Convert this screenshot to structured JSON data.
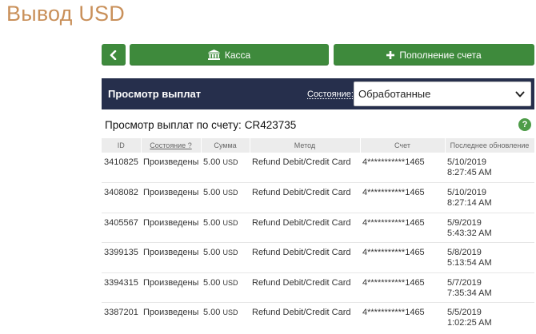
{
  "page": {
    "title": "Вывод USD"
  },
  "toolbar": {
    "kassa_label": "Касса",
    "topup_label": "Пополнение счета"
  },
  "panel": {
    "title": "Просмотр выплат",
    "state_label": "Состояние:",
    "state_value": "Обработанные"
  },
  "account": {
    "label": "Просмотр выплат по счету:",
    "number": "CR423735"
  },
  "help": {
    "label": "?"
  },
  "table": {
    "headers": {
      "id": "ID",
      "state": "Состояние ?",
      "sum": "Сумма",
      "method": "Метод",
      "account": "Счет",
      "updated": "Последнее обновление"
    },
    "rows": [
      {
        "id": "3410825",
        "state": "Произведены",
        "amount": "5.00",
        "currency": "USD",
        "method": "Refund Debit/Credit Card",
        "account": "4***********1465",
        "date": "5/10/2019",
        "time": "8:27:45 AM"
      },
      {
        "id": "3408082",
        "state": "Произведены",
        "amount": "5.00",
        "currency": "USD",
        "method": "Refund Debit/Credit Card",
        "account": "4***********1465",
        "date": "5/10/2019",
        "time": "8:27:14 AM"
      },
      {
        "id": "3405567",
        "state": "Произведены",
        "amount": "5.00",
        "currency": "USD",
        "method": "Refund Debit/Credit Card",
        "account": "4***********1465",
        "date": "5/9/2019",
        "time": "5:43:32 AM"
      },
      {
        "id": "3399135",
        "state": "Произведены",
        "amount": "5.00",
        "currency": "USD",
        "method": "Refund Debit/Credit Card",
        "account": "4***********1465",
        "date": "5/8/2019",
        "time": "5:13:54 AM"
      },
      {
        "id": "3394315",
        "state": "Произведены",
        "amount": "5.00",
        "currency": "USD",
        "method": "Refund Debit/Credit Card",
        "account": "4***********1465",
        "date": "5/7/2019",
        "time": "7:35:34 AM"
      },
      {
        "id": "3387201",
        "state": "Произведены",
        "amount": "5.00",
        "currency": "USD",
        "method": "Refund Debit/Credit Card",
        "account": "4***********1465",
        "date": "5/5/2019",
        "time": "1:02:25 AM"
      }
    ]
  },
  "icons": {
    "back": "chevron-left-icon",
    "kassa": "bank-icon",
    "topup": "plus-icon",
    "select": "chevron-down-icon",
    "help": "help-icon"
  },
  "colors": {
    "title": "#c9905a",
    "button": "#3e8a3c",
    "panel_header": "#262f4c",
    "table_header": "#ececec"
  }
}
